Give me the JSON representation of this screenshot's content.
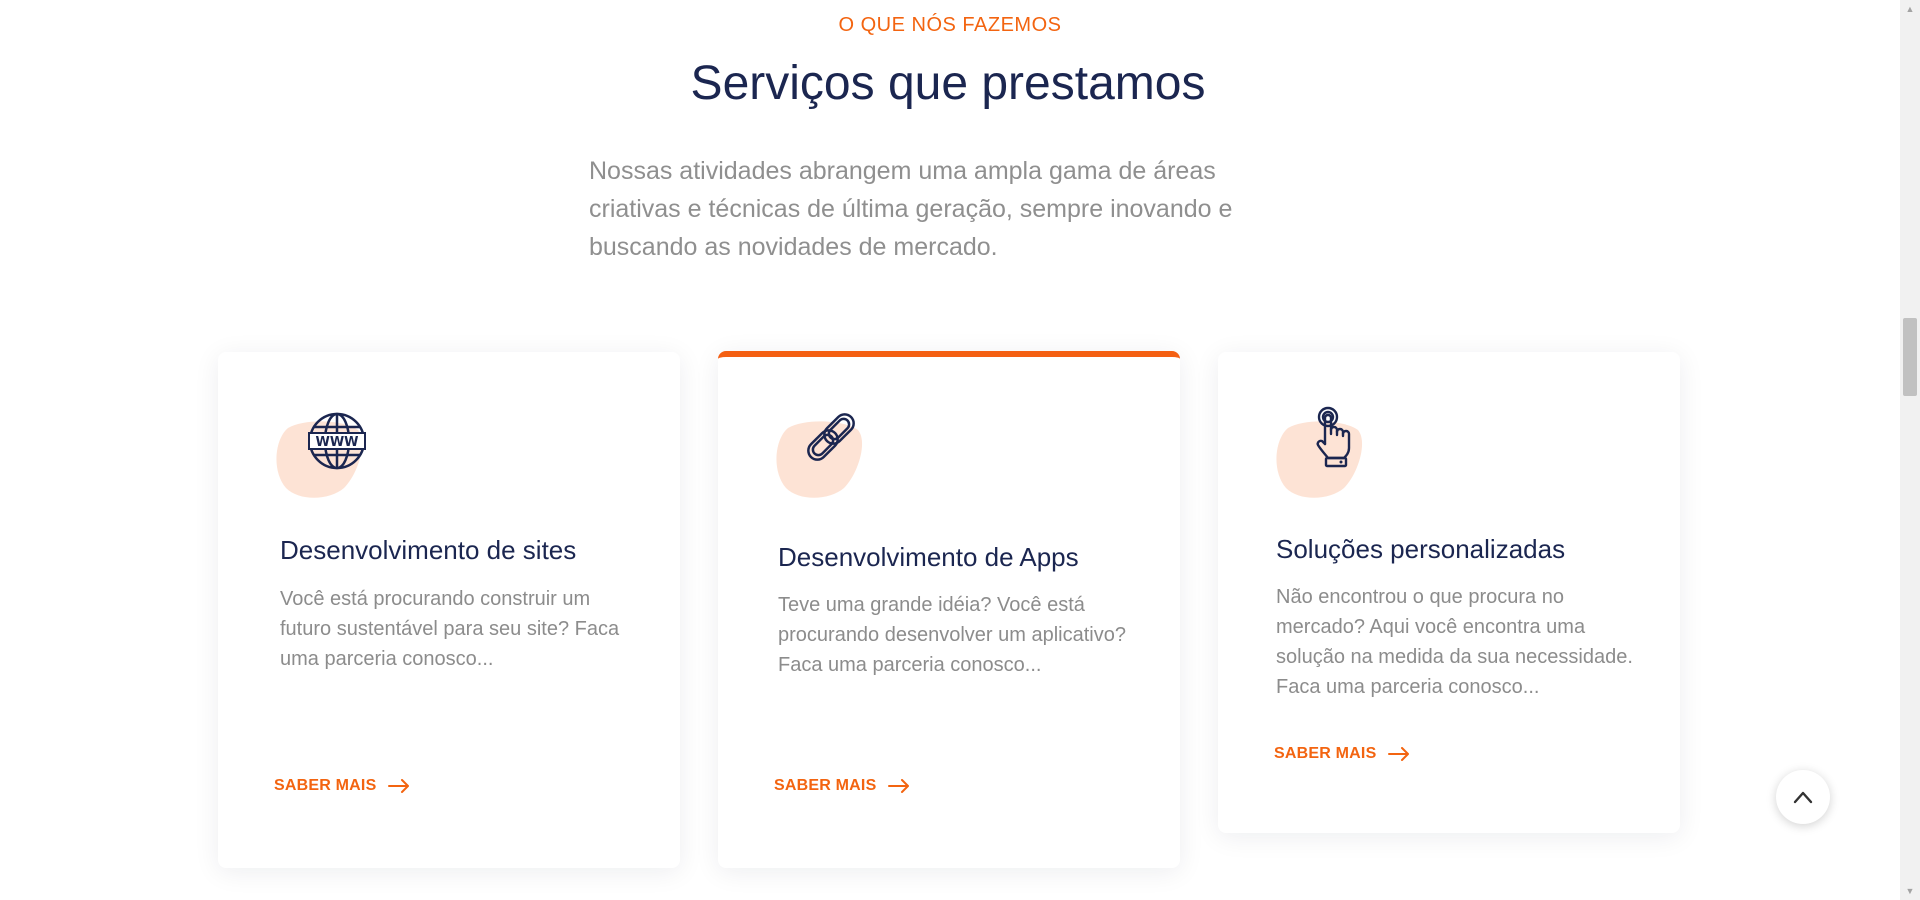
{
  "section": {
    "eyebrow": "O QUE NÓS FAZEMOS",
    "title": "Serviços que prestamos",
    "intro": "Nossas atividades abrangem uma ampla gama de áreas criativas e técnicas de última geração, sempre inovando e buscando as novidades de mercado."
  },
  "cards": [
    {
      "icon": "globe-www-icon",
      "title": "Desenvolvimento de sites",
      "description": "Você está procurando construir um futuro sustentável para seu site? Faca uma parceria conosco...",
      "link_label": "SABER MAIS"
    },
    {
      "icon": "chain-link-icon",
      "title": "Desenvolvimento de Apps",
      "description": "Teve uma grande idéia? Você está procurando desenvolver um aplicativo? Faca uma parceria conosco...",
      "link_label": "SABER MAIS"
    },
    {
      "icon": "touch-hand-icon",
      "title": "Soluções personalizadas",
      "description": "Não encontrou o que procura no mercado? Aqui você encontra uma solução na medida da sua necessidade. Faca uma parceria conosco...",
      "link_label": "SABER MAIS"
    }
  ],
  "colors": {
    "accent": "#f36410",
    "heading": "#1b2650",
    "body_text": "#8c8c8c",
    "icon_blob": "#fde3d5"
  }
}
